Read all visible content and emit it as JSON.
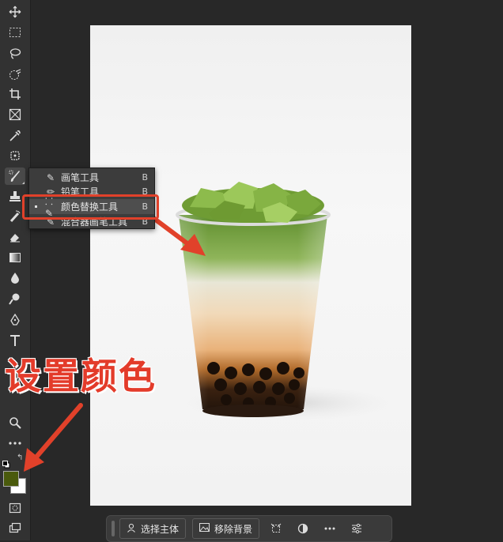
{
  "toolbar": {
    "foreground_color": "#4a5a0c",
    "background_color": "#ffffff",
    "tools": [
      {
        "name": "move-tool"
      },
      {
        "name": "marquee-tool"
      },
      {
        "name": "lasso-tool"
      },
      {
        "name": "object-selection-tool"
      },
      {
        "name": "crop-tool"
      },
      {
        "name": "frame-tool"
      },
      {
        "name": "eyedropper-tool"
      },
      {
        "name": "spot-healing-tool"
      },
      {
        "name": "brush-tool"
      },
      {
        "name": "clone-stamp-tool"
      },
      {
        "name": "history-brush-tool"
      },
      {
        "name": "eraser-tool"
      },
      {
        "name": "gradient-tool"
      },
      {
        "name": "blur-tool"
      },
      {
        "name": "dodge-tool"
      },
      {
        "name": "pen-tool"
      },
      {
        "name": "type-tool"
      },
      {
        "name": "path-selection-tool"
      },
      {
        "name": "hand-tool"
      },
      {
        "name": "zoom-tool"
      },
      {
        "name": "more-tools"
      }
    ]
  },
  "flyout": {
    "items": [
      {
        "label": "画笔工具",
        "shortcut": "B",
        "icon": "brush-icon"
      },
      {
        "label": "铅笔工具",
        "shortcut": "B",
        "icon": "pencil-icon"
      },
      {
        "label": "颜色替换工具",
        "shortcut": "B",
        "icon": "color-replacement-icon",
        "selected": true
      },
      {
        "label": "混合器画笔工具",
        "shortcut": "B",
        "icon": "mixer-brush-icon"
      }
    ]
  },
  "annotation": {
    "text": "设置颜色",
    "color": "#e33b2a"
  },
  "taskbar": {
    "select_subject": "选择主体",
    "remove_background": "移除背景"
  },
  "colors": {
    "accent_red": "#e1412a",
    "matcha_green": "#5a8c2a"
  }
}
